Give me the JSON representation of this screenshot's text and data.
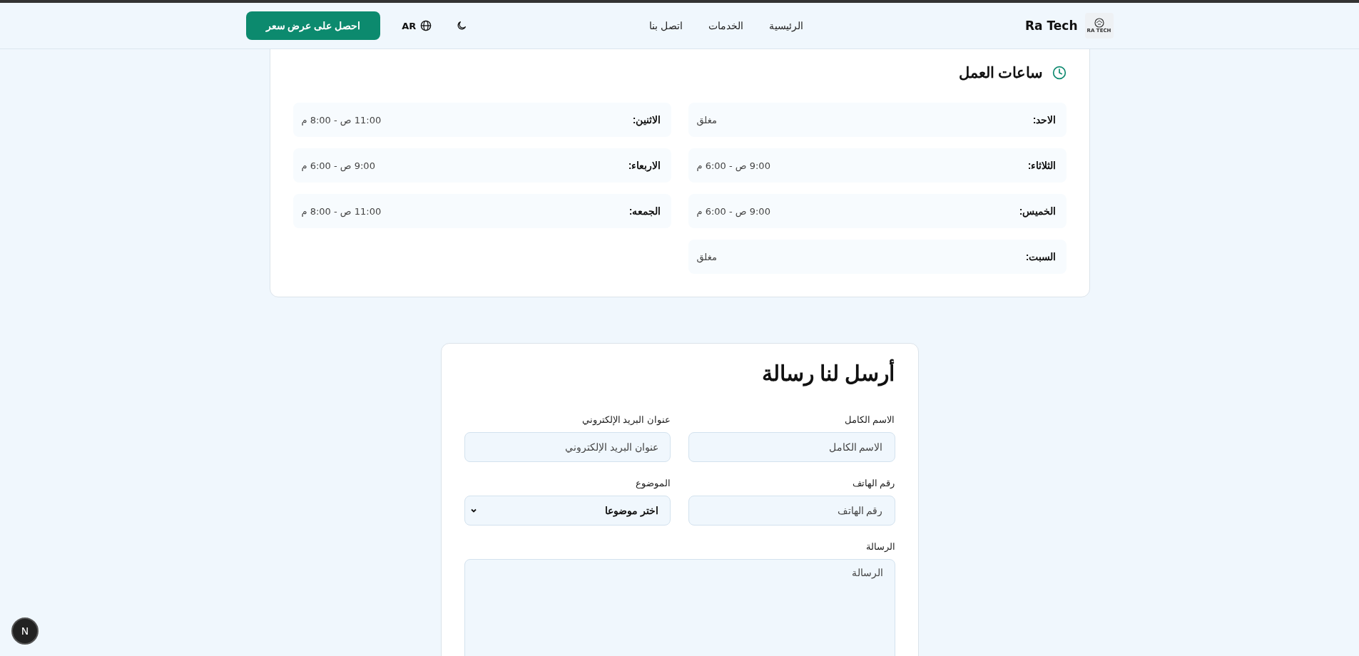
{
  "header": {
    "logo_text": "RA TECH",
    "brand": "Ra Tech",
    "nav": [
      {
        "label": "الرئيسية"
      },
      {
        "label": "الخدمات"
      },
      {
        "label": "اتصل بنا"
      }
    ],
    "language": "AR",
    "cta": "احصل على عرض سعر"
  },
  "hours": {
    "title": "ساعات العمل",
    "days": [
      {
        "day": "الاحد:",
        "hours": "مغلق"
      },
      {
        "day": "الاثنين:",
        "hours": "11:00 ص - 8:00 م"
      },
      {
        "day": "الثلاثاء:",
        "hours": "9:00 ص - 6:00 م"
      },
      {
        "day": "الاربعاء:",
        "hours": "9:00 ص - 6:00 م"
      },
      {
        "day": "الخميس:",
        "hours": "9:00 ص - 6:00 م"
      },
      {
        "day": "الجمعه:",
        "hours": "11:00 ص - 8:00 م"
      },
      {
        "day": "السبت:",
        "hours": "مغلق"
      }
    ]
  },
  "form": {
    "title": "أرسل لنا رسالة",
    "fields": [
      {
        "kind": "input",
        "label": "الاسم الكامل",
        "placeholder": "الاسم الكامل"
      },
      {
        "kind": "input",
        "label": "عنوان البريد الإلكتروني",
        "placeholder": "عنوان البريد الإلكتروني"
      },
      {
        "kind": "input",
        "label": "رقم الهاتف",
        "placeholder": "رقم الهاتف"
      },
      {
        "kind": "select",
        "label": "الموضوع",
        "value": "اختر موضوعا"
      },
      {
        "kind": "textarea",
        "label": "الرسالة",
        "placeholder": "الرسالة"
      }
    ]
  },
  "dev_badge": "N"
}
